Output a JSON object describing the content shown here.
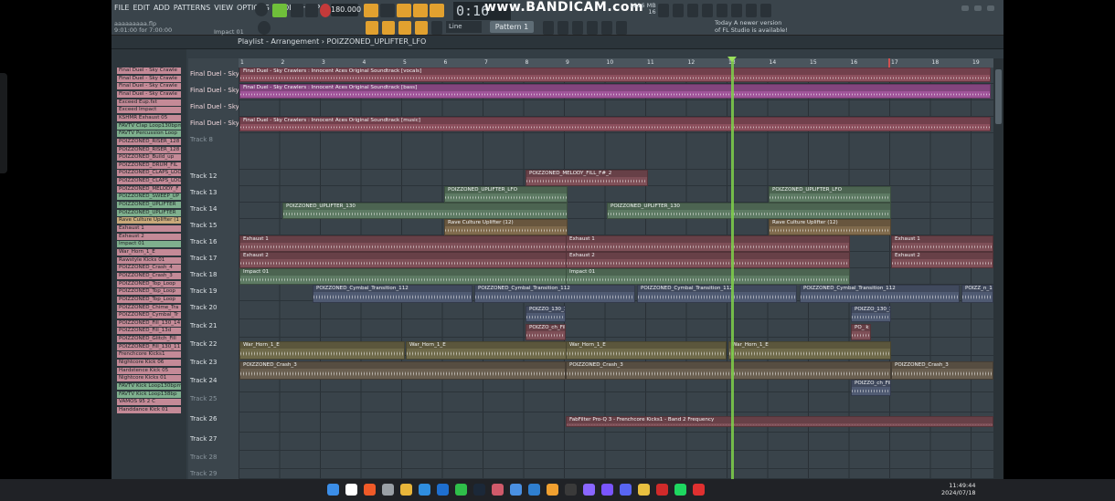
{
  "menu": [
    "FILE",
    "EDIT",
    "ADD",
    "PATTERNS",
    "VIEW",
    "OPTIONS",
    "TOOLS",
    "HELP"
  ],
  "transport": {
    "time": "0:16",
    "tempo": "180.000",
    "pattern": "Pattern 1",
    "snap": "Line"
  },
  "watermark": "www.BANDICAM.com",
  "hint": {
    "file": "aaaaaaaaa.flp",
    "position": "9:01:00 for 7:00:00",
    "current": "Impact 01"
  },
  "memory": {
    "mb": "1216 MB",
    "cpu": "16"
  },
  "news": "Today A newer version of FL Studio is available!",
  "breadcrumb": "Playlist - Arrangement › POIZZONED_UPLIFTER_LFO",
  "browser": [
    {
      "label": "Final Duel - Sky Crawle",
      "color": "#c48a97"
    },
    {
      "label": "Final Duel - Sky Crawle",
      "color": "#c48a97"
    },
    {
      "label": "Final Duel - Sky Crawle",
      "color": "#c48a97"
    },
    {
      "label": "Final Duel - Sky Crawle",
      "color": "#c48a97"
    },
    {
      "label": "Exceed Eup.fxt",
      "color": "#c48a97"
    },
    {
      "label": "Exceed Impact",
      "color": "#c48a97"
    },
    {
      "label": "KSHMR Exhaust 05",
      "color": "#c48a97"
    },
    {
      "label": "FAVTV Clap Loop130bpm",
      "color": "#7fb08e"
    },
    {
      "label": "FAVTV Percussion Loop",
      "color": "#7fb08e"
    },
    {
      "label": "POIZZONED_RISER_128",
      "color": "#c48a97"
    },
    {
      "label": "POIZZONED_RISER_128",
      "color": "#c48a97"
    },
    {
      "label": "POIZZONED_Build_up",
      "color": "#c48a97"
    },
    {
      "label": "POIZZONED_DRUM_FIL",
      "color": "#c48a97"
    },
    {
      "label": "POIZZONED_CLAPS_LOO",
      "color": "#c48a97"
    },
    {
      "label": "POIZZONED_CLAPS_LOO",
      "color": "#c48a97"
    },
    {
      "label": "POIZZONED_MELODY_F",
      "color": "#c48a97"
    },
    {
      "label": "POIZZONED_SWEEP_UP",
      "color": "#7fb08e"
    },
    {
      "label": "POIZZONED_UPLIFTER",
      "color": "#7fb08e"
    },
    {
      "label": "POIZZONED_UPLIFTER",
      "color": "#7fb08e"
    },
    {
      "label": "Rave Culture Uplifter (1",
      "color": "#c9a97a"
    },
    {
      "label": "Exhaust 1",
      "color": "#c48a97"
    },
    {
      "label": "Exhaust 2",
      "color": "#c48a97"
    },
    {
      "label": "Impact 01",
      "color": "#7fb08e"
    },
    {
      "label": "War_Horn_1_E",
      "color": "#c48a97"
    },
    {
      "label": "Rawstyle Kicks 01",
      "color": "#c48a97"
    },
    {
      "label": "POIZZONED_Crash_4",
      "color": "#c48a97"
    },
    {
      "label": "POIZZONED_Crash_3",
      "color": "#c48a97"
    },
    {
      "label": "POIZZONED_Top_Loop",
      "color": "#c48a97"
    },
    {
      "label": "POIZZONED_Top_Loop",
      "color": "#c48a97"
    },
    {
      "label": "POIZZONED_Top_Loop",
      "color": "#c48a97"
    },
    {
      "label": "POIZZONED_Chime_Tra",
      "color": "#c48a97"
    },
    {
      "label": "POIZZONED_Cymbal_Tr",
      "color": "#c48a97"
    },
    {
      "label": "POIZZONED_Fill_130_14",
      "color": "#c48a97"
    },
    {
      "label": "POIZZONED_Fill_13d",
      "color": "#c48a97"
    },
    {
      "label": "POIZZONED_Glitch_Fill",
      "color": "#c48a97"
    },
    {
      "label": "POIZZONED_Fill_130_11",
      "color": "#c48a97"
    },
    {
      "label": "Frenchcore Kicks1",
      "color": "#c48a97"
    },
    {
      "label": "Nightcore Kick 06",
      "color": "#c48a97"
    },
    {
      "label": "Hardstence Kick 05",
      "color": "#c48a97"
    },
    {
      "label": "Nightcore Kicks 01",
      "color": "#c48a97"
    },
    {
      "label": "FAVTV Kick Loop130bpm",
      "color": "#7fb08e"
    },
    {
      "label": "FAVTV Kick Loop138bp",
      "color": "#7fb08e"
    },
    {
      "label": "VAMOS 95 2 C",
      "color": "#c48a97"
    },
    {
      "label": "Handdance Kick 01",
      "color": "#c48a97"
    }
  ],
  "ruler": [
    "1",
    "2",
    "3",
    "4",
    "5",
    "6",
    "7",
    "8",
    "9",
    "10",
    "11",
    "12",
    "13",
    "14",
    "15",
    "16",
    "17",
    "18",
    "19"
  ],
  "tracks": [
    {
      "label": "Final Duel - Sky Cr"
    },
    {
      "label": "Final Duel - Sky Cr"
    },
    {
      "label": "Final Duel - Sky Cr"
    },
    {
      "label": "Final Duel - Sky Cr"
    },
    {
      "label": "Track 8"
    },
    {
      "label": "Track 12"
    },
    {
      "label": "Track 13"
    },
    {
      "label": "Track 14"
    },
    {
      "label": "Track 15"
    },
    {
      "label": "Track 16"
    },
    {
      "label": "Track 17"
    },
    {
      "label": "Track 18"
    },
    {
      "label": "Track 19"
    },
    {
      "label": "Track 20"
    },
    {
      "label": "Track 21"
    },
    {
      "label": "Track 22"
    },
    {
      "label": "Track 23"
    },
    {
      "label": "Track 24"
    },
    {
      "label": "Track 25"
    },
    {
      "label": "Track 26"
    },
    {
      "label": "Track 27"
    },
    {
      "label": "Track 28"
    },
    {
      "label": "Track 29"
    }
  ],
  "clips": [
    {
      "label": "Final Duel - Sky Crawlers :  Innocent Aces Original Soundtrack [vocals]",
      "color": "#8c4f5d"
    },
    {
      "label": "Final Duel - Sky Crawlers :  Innocent Aces Original Soundtrack [bass]",
      "color": "#a0559a"
    },
    {
      "label": "Final Duel - Sky Crawlers :  Innocent Aces Original Soundtrack [music]",
      "color": "#8c4f5d"
    },
    {
      "label": "POIZZONED_MELODY_FILL_F#_2",
      "color": "#7e4f57"
    },
    {
      "label": "POIZZONED_UPLIFTER_LFO",
      "color": "#5d7a63"
    },
    {
      "label": "POIZZONED_UPLIFTER_LFO",
      "color": "#5d7a63"
    },
    {
      "label": "POIZZONED_UPLIFTER_130",
      "color": "#5d7a63"
    },
    {
      "label": "POIZZONED_UPLIFTER_130",
      "color": "#5d7a63"
    },
    {
      "label": "Rave Culture Uplifter (12)",
      "color": "#7f6a4c"
    },
    {
      "label": "Rave Culture Uplifter (12)",
      "color": "#7f6a4c"
    },
    {
      "label": "Exhaust 1",
      "color": "#7e4f57"
    },
    {
      "label": "Exhaust 1",
      "color": "#7e4f57"
    },
    {
      "label": "Exhaust 1",
      "color": "#7e4f57"
    },
    {
      "label": "Exhaust 2",
      "color": "#7e4f57"
    },
    {
      "label": "Exhaust 2",
      "color": "#7e4f57"
    },
    {
      "label": "Exhaust 2",
      "color": "#7e4f57"
    },
    {
      "label": "Impact 01",
      "color": "#5d7a63"
    },
    {
      "label": "Impact 01",
      "color": "#5d7a63"
    },
    {
      "label": "POIZZONED_Cymbal_Transition_112",
      "color": "#4f5a72"
    },
    {
      "label": "POIZZONED_Cymbal_Transition_112",
      "color": "#4f5a72"
    },
    {
      "label": "POIZZONED_Cymbal_Transition_112",
      "color": "#4f5a72"
    },
    {
      "label": "POIZZONED_Cymbal_Transition_112",
      "color": "#4f5a72"
    },
    {
      "label": "POIZZ_n_112",
      "color": "#4f5a72"
    },
    {
      "label": "POIZZO_130_11",
      "color": "#4f5a72"
    },
    {
      "label": "POIZZO_130_14",
      "color": "#4f5a72"
    },
    {
      "label": "POIZZO_ch_Fill",
      "color": "#7e4f57"
    },
    {
      "label": "PO_ k",
      "color": "#7e4f57"
    },
    {
      "label": "War_Horn_1_E",
      "color": "#6f6a4a"
    },
    {
      "label": "War_Horn_1_E",
      "color": "#6f6a4a"
    },
    {
      "label": "War_Horn_1_E",
      "color": "#6f6a4a"
    },
    {
      "label": "War_Horn_1_E",
      "color": "#6f6a4a"
    },
    {
      "label": "POIZZONED_Crash_3",
      "color": "#6a5f50"
    },
    {
      "label": "POIZZONED_Crash_3",
      "color": "#6a5f50"
    },
    {
      "label": "POIZZONED_Crash_3",
      "color": "#6a5f50"
    },
    {
      "label": "POIZZO_ch_Fill",
      "color": "#4f5a72"
    },
    {
      "label": "FabFilter Pro-Q 3 - Frenchcore Kicks1 - Band 2 Frequency",
      "color": "#7e4f57"
    }
  ],
  "taskbar_icons": [
    "windows-icon",
    "search-icon",
    "brave-icon",
    "settings-icon",
    "folder-icon",
    "edge-icon",
    "mail-icon",
    "xbox-icon",
    "steam-icon",
    "game-icon",
    "fl-icon",
    "vscode-icon",
    "flstudio-icon",
    "obs-icon",
    "premiere-icon",
    "aftereffects-icon",
    "discord-icon",
    "chrome-icon",
    "opera-icon",
    "spotify-icon",
    "record-icon"
  ],
  "clock": {
    "time": "11:49:44",
    "date": "2024/07/18"
  }
}
